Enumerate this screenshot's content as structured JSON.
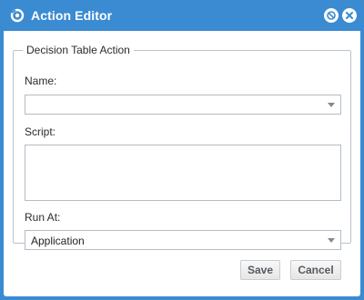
{
  "window": {
    "title": "Action Editor",
    "app_icon": "swirl-icon",
    "controls": [
      {
        "name": "help",
        "icon": "circle-slash-icon"
      },
      {
        "name": "close",
        "icon": "close-icon"
      }
    ]
  },
  "group": {
    "legend": "Decision Table Action"
  },
  "fields": {
    "name_label": "Name:",
    "name_value": "",
    "script_label": "Script:",
    "script_value": "",
    "run_at_label": "Run At:",
    "run_at_value": "Application"
  },
  "buttons": {
    "save": "Save",
    "cancel": "Cancel"
  },
  "colors": {
    "titlebar": "#3a8bd1",
    "border": "#b5bcc4"
  }
}
